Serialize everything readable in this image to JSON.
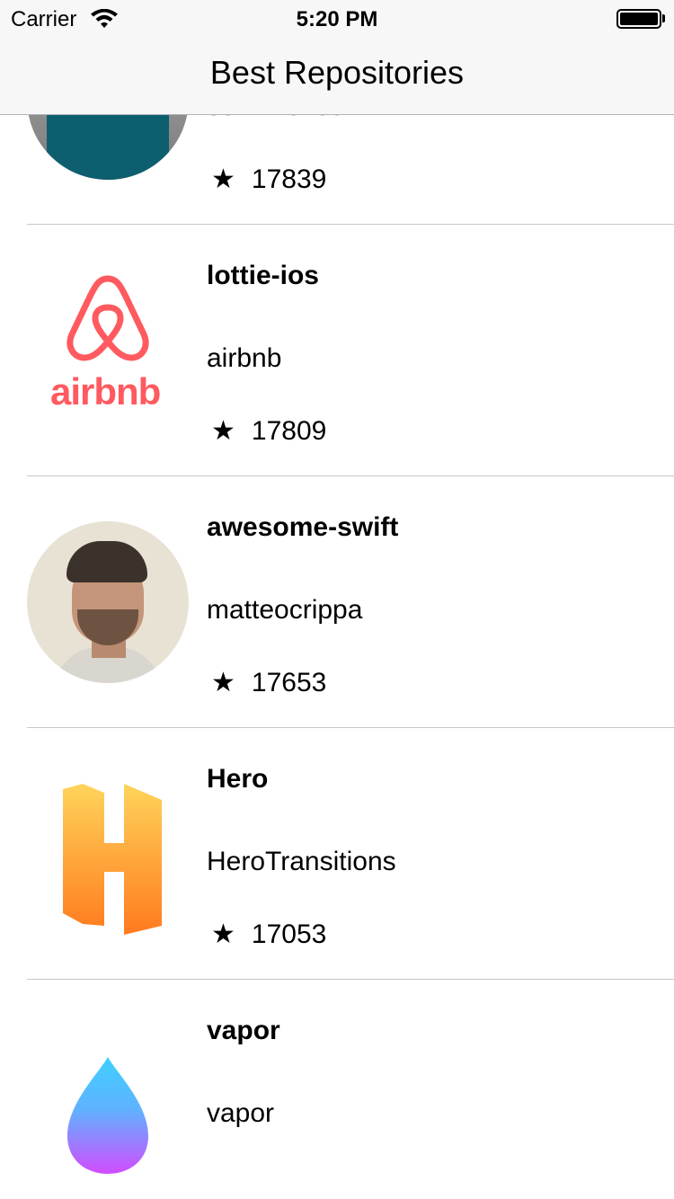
{
  "status_bar": {
    "carrier": "Carrier",
    "time": "5:20 PM",
    "wifi_icon": "wifi-icon",
    "battery_icon": "battery-icon",
    "battery_level": 1.0
  },
  "nav": {
    "title": "Best Repositories"
  },
  "star_glyph": "★",
  "repos": [
    {
      "name": "",
      "owner": "sernii-iondar",
      "stars": "17839",
      "avatar": "photo-avatar"
    },
    {
      "name": "lottie-ios",
      "owner": "airbnb",
      "stars": "17809",
      "avatar": "airbnb-logo",
      "logo_text": "airbnb",
      "logo_color": "#ff5a5f"
    },
    {
      "name": "awesome-swift",
      "owner": "matteocrippa",
      "stars": "17653",
      "avatar": "photo-avatar"
    },
    {
      "name": "Hero",
      "owner": "HeroTransitions",
      "stars": "17053",
      "avatar": "hero-logo"
    },
    {
      "name": "vapor",
      "owner": "vapor",
      "stars": "",
      "avatar": "vapor-logo"
    }
  ]
}
